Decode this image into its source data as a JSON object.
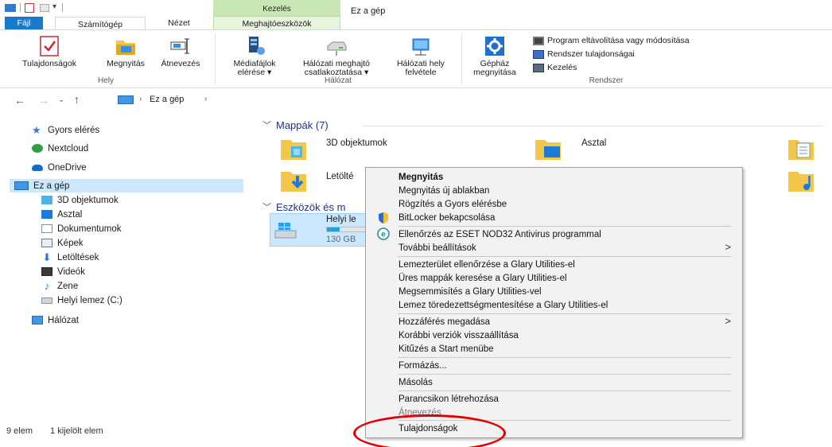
{
  "ribbon_tabs": {
    "file": "Fájl",
    "computer": "Számítógép",
    "view": "Nézet",
    "drive_tools": "Meghajtóeszközök",
    "context": "Kezelés"
  },
  "window_title": "Ez a gép",
  "ribbon": {
    "properties": "Tulajdonságok",
    "open": "Megnyitás",
    "rename": "Átnevezés",
    "group_location": "Hely",
    "media1": "Médiafájlok",
    "media2": "elérése ▾",
    "mapdrive1": "Hálózati meghajtó",
    "mapdrive2": "csatlakoztatása ▾",
    "netloc1": "Hálózati hely",
    "netloc2": "felvétele",
    "group_network": "Hálózat",
    "settings1": "Gépház",
    "settings2": "megnyitása",
    "uninstall": "Program eltávolítása vagy módosítása",
    "sysprops": "Rendszer tulajdonságai",
    "manage": "Kezelés",
    "group_system": "Rendszer"
  },
  "address": {
    "path": "Ez a gép"
  },
  "nav": {
    "quick": "Gyors elérés",
    "nextcloud": "Nextcloud",
    "onedrive": "OneDrive",
    "thispc": "Ez a gép",
    "obj3d": "3D objektumok",
    "desktop": "Asztal",
    "documents": "Dokumentumok",
    "pictures": "Képek",
    "downloads": "Letöltések",
    "videos": "Videók",
    "music": "Zene",
    "localdisk": "Helyi lemez (C:)",
    "network": "Hálózat"
  },
  "content": {
    "folders_header": "Mappák (7)",
    "f_3d": "3D objektumok",
    "f_desktop": "Asztal",
    "f_downloads": "Letölté",
    "devices_header": "Eszközök és m",
    "disk_name": "Helyi le",
    "disk_size": "130 GB",
    "disk_fill": 0.3
  },
  "status": {
    "items": "9 elem",
    "selected": "1 kijelölt elem"
  },
  "menu": {
    "open": "Megnyitás",
    "open_new": "Megnyitás új ablakban",
    "pin_quick": "Rögzítés a Gyors elérésbe",
    "bitlocker": "BitLocker bekapcsolása",
    "eset": "Ellenőrzés az ESET NOD32 Antivirus programmal",
    "more": "További beállítások",
    "g1": "Lemezterület ellenőrzése a Glary Utilities-el",
    "g2": "Üres mappák keresése a Glary Utilities-el",
    "g3": "Megsemmisítés a Glary Utilities-vel",
    "g4": "Lemez töredezettségmentesítése a Glary Utilities-el",
    "access": "Hozzáférés megadása",
    "restore": "Korábbi verziók visszaállítása",
    "pin_start": "Kitűzés a Start menübe",
    "format": "Formázás...",
    "copy": "Másolás",
    "shortcut": "Parancsikon létrehozása",
    "rename": "Átnevezés",
    "properties": "Tulajdonságok",
    "arrow": ">"
  },
  "colors": {
    "accent": "#1979ca",
    "highlight": "#cce8ff",
    "annotation": "#e00000",
    "context_tab": "#c9e7b4",
    "folder": "#f3c84a"
  }
}
